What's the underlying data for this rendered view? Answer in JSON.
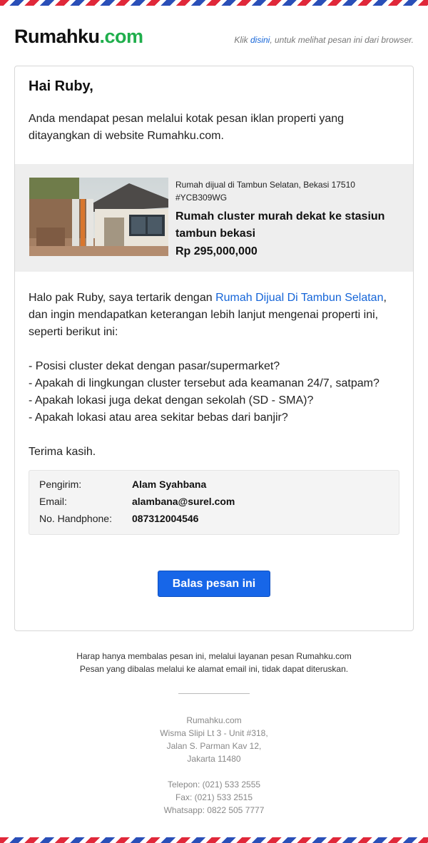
{
  "header": {
    "logo_main": "Rumahku",
    "logo_tld": ".com",
    "browser_note_prefix": "Klik ",
    "browser_note_link": "disini",
    "browser_note_suffix": ", untuk melihat pesan ini dari browser."
  },
  "card": {
    "greeting": "Hai Ruby,",
    "intro": "Anda mendapat pesan melalui kotak pesan iklan properti yang ditayangkan di website Rumahku.com."
  },
  "listing": {
    "location": "Rumah dijual di Tambun Selatan, Bekasi 17510",
    "code": "#YCB309WG",
    "title": "Rumah cluster murah dekat ke stasiun tambun bekasi",
    "price": "Rp 295,000,000"
  },
  "message": {
    "line1_prefix": "Halo pak Ruby, saya tertarik dengan ",
    "line1_link": "Rumah Dijual Di Tambun Selatan",
    "line1_suffix": ", dan ingin mendapatkan keterangan lebih lanjut mengenai properti ini, seperti berikut ini:",
    "questions": [
      "- Posisi cluster dekat dengan pasar/supermarket?",
      "- Apakah di lingkungan cluster tersebut ada keamanan 24/7, satpam?",
      "- Apakah lokasi juga dekat dengan sekolah (SD - SMA)?",
      "- Apakah lokasi atau area sekitar bebas dari banjir?"
    ],
    "closing": "Terima kasih."
  },
  "sender": {
    "name_label": "Pengirim:",
    "name_value": "Alam Syahbana",
    "email_label": "Email:",
    "email_value": "alambana@surel.com",
    "phone_label": "No. Handphone:",
    "phone_value": "087312004546"
  },
  "reply_button": "Balas pesan ini",
  "footer": {
    "note_line1": "Harap hanya membalas pesan ini, melalui layanan pesan Rumahku.com",
    "note_line2": "Pesan yang dibalas melalui ke alamat email ini, tidak dapat diteruskan.",
    "company": "Rumahku.com",
    "address_line1": "Wisma Slipi Lt 3 - Unit #318,",
    "address_line2": "Jalan S. Parman Kav 12,",
    "address_line3": "Jakarta 11480",
    "phone": "Telepon: (021) 533 2555",
    "fax": "Fax: (021) 533 2515",
    "whatsapp": "Whatsapp: 0822 505 7777"
  },
  "colors": {
    "brand_green": "#1fae4c",
    "link_blue": "#1565d8",
    "button_blue": "#1766e8",
    "airmail_red": "#e0283a",
    "airmail_blue": "#2a4fb8"
  }
}
